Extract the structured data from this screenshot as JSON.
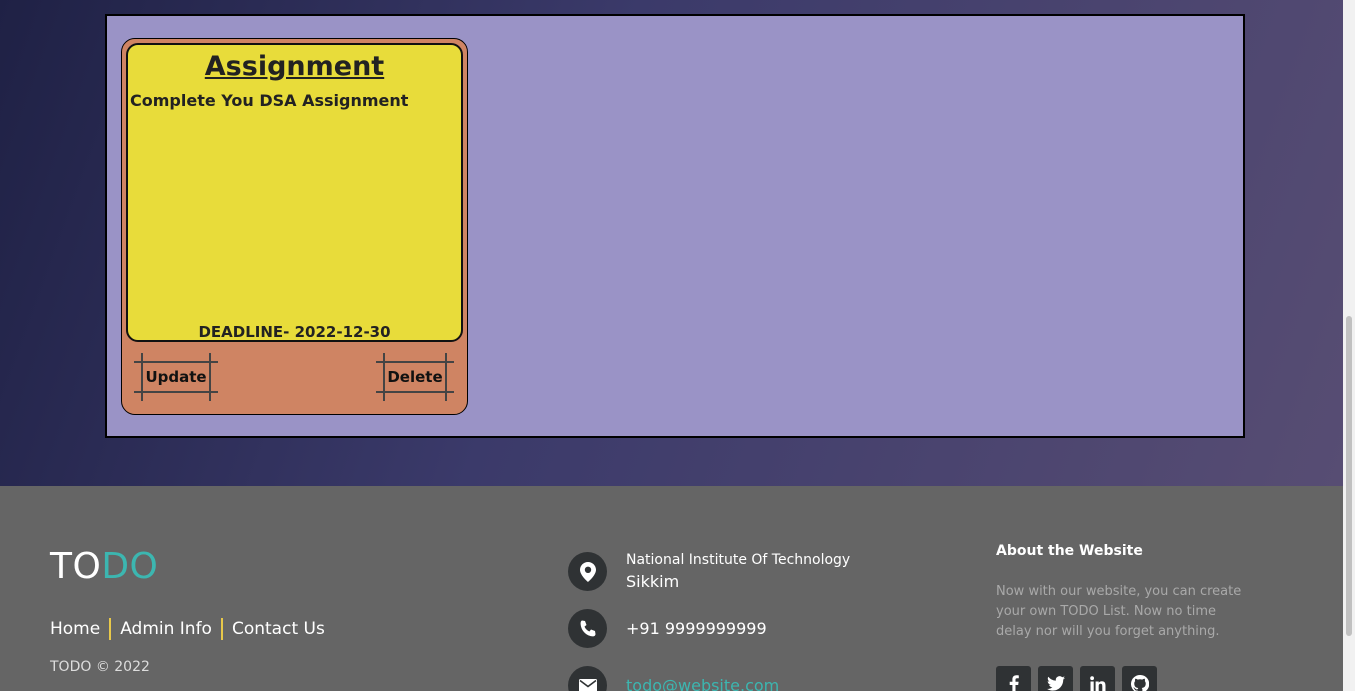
{
  "card": {
    "title": "Assignment",
    "description": "Complete You DSA Assignment",
    "deadline": "DEADLINE- 2022-12-30",
    "update_label": "Update",
    "delete_label": "Delete"
  },
  "footer": {
    "brand_part1": "TO",
    "brand_part2": "DO",
    "nav": [
      "Home",
      "Admin Info",
      "Contact Us"
    ],
    "copyright": "TODO © 2022",
    "address_line1": "National Institute Of Technology",
    "address_line2": "Sikkim",
    "phone": "+91 9999999999",
    "email": "todo@website.com",
    "about_title": "About the Website",
    "about_text": "Now with our website, you can create your own TODO List. Now no time delay nor will you forget anything.",
    "socials": [
      "facebook-icon",
      "twitter-icon",
      "linkedin-icon",
      "github-icon"
    ]
  },
  "colors": {
    "board": "#9a93c6",
    "card": "#cf8463",
    "note": "#e8dc3a",
    "footer": "#656565",
    "accent": "#3cb6b0"
  }
}
